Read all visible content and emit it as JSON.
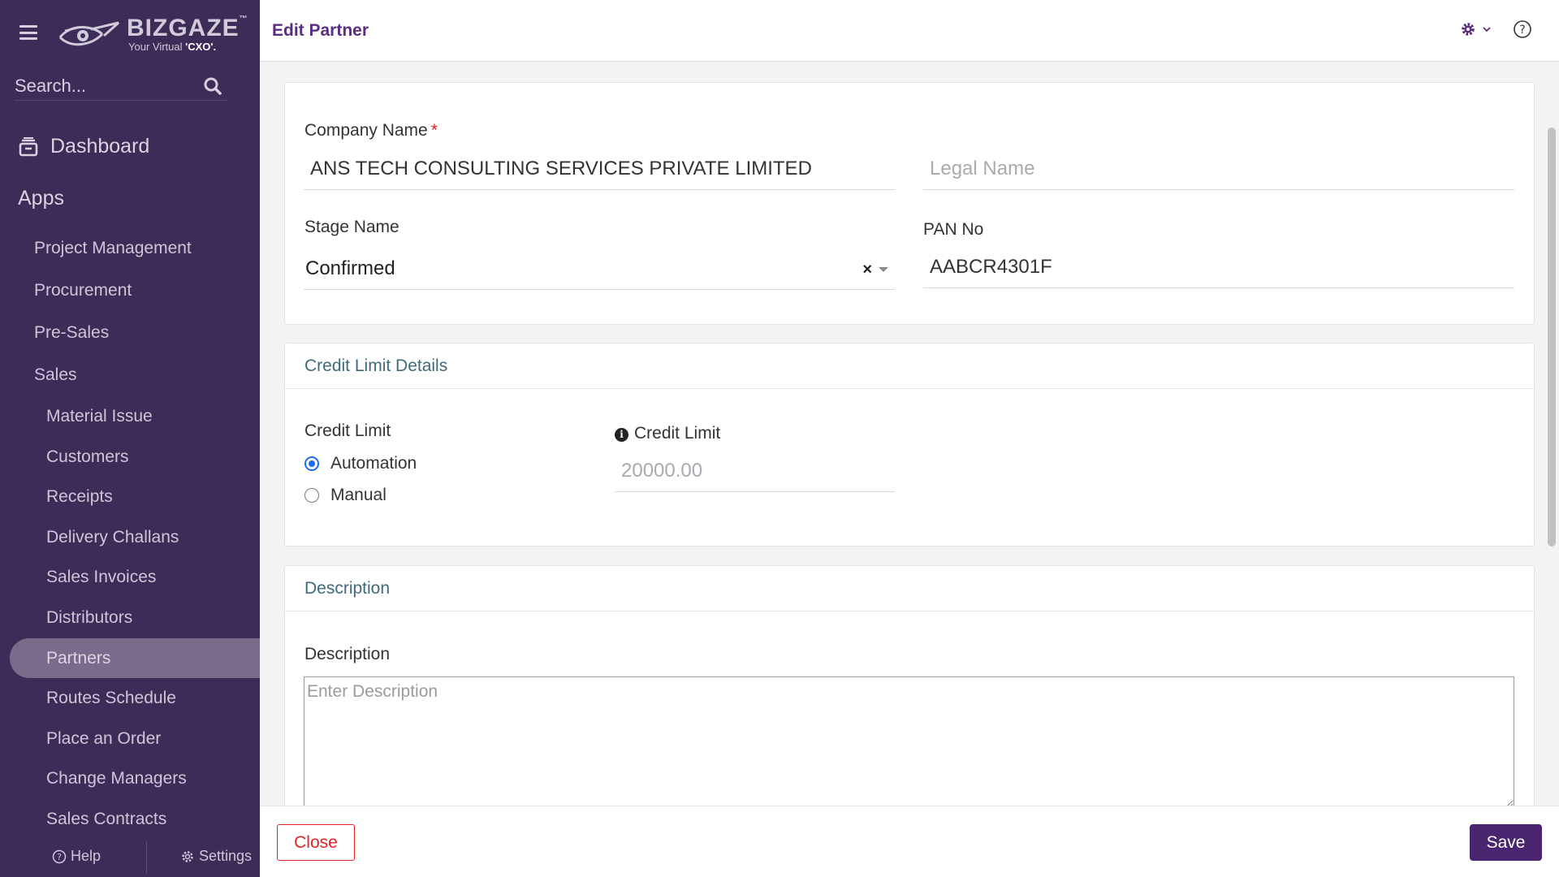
{
  "brand": {
    "name": "BIZGAZE",
    "trademark": "™",
    "tagline_prefix": "Your Virtual ",
    "tagline_strong": "'CXO'."
  },
  "sidebar": {
    "search_placeholder": "Search...",
    "dashboard_label": "Dashboard",
    "apps_label": "Apps",
    "items": [
      {
        "label": "Project Management",
        "level": 1
      },
      {
        "label": "Procurement",
        "level": 1
      },
      {
        "label": "Pre-Sales",
        "level": 1
      },
      {
        "label": "Sales",
        "level": 1
      }
    ],
    "sales_items": [
      {
        "label": "Material Issue"
      },
      {
        "label": "Customers"
      },
      {
        "label": "Receipts"
      },
      {
        "label": "Delivery Challans"
      },
      {
        "label": "Sales Invoices"
      },
      {
        "label": "Distributors"
      },
      {
        "label": "Partners",
        "active": true
      },
      {
        "label": "Routes Schedule"
      },
      {
        "label": "Place an Order"
      },
      {
        "label": "Change Managers"
      },
      {
        "label": "Sales Contracts"
      }
    ],
    "footer": {
      "help_label": "Help",
      "settings_label": "Settings"
    }
  },
  "header": {
    "title": "Edit Partner"
  },
  "form": {
    "company_name": {
      "label": "Company Name",
      "required_mark": "*",
      "value": "ANS TECH CONSULTING SERVICES PRIVATE LIMITED"
    },
    "legal_name": {
      "placeholder": "Legal Name",
      "value": ""
    },
    "stage_name": {
      "label": "Stage Name",
      "value": "Confirmed",
      "clear": "×"
    },
    "pan_no": {
      "label": "PAN No",
      "value": "AABCR4301F"
    }
  },
  "credit_section": {
    "title": "Credit Limit Details",
    "credit_limit_label": "Credit Limit",
    "options": [
      {
        "label": "Automation",
        "selected": true
      },
      {
        "label": "Manual",
        "selected": false
      }
    ],
    "amount_label": "Credit Limit",
    "amount_placeholder": "20000.00"
  },
  "description_section": {
    "title": "Description",
    "label": "Description",
    "placeholder": "Enter Description"
  },
  "actions": {
    "close_label": "Close",
    "save_label": "Save"
  },
  "colors": {
    "sidebar_bg": "#3e2c58",
    "title_purple": "#5a2d82",
    "save_bg": "#4a2670",
    "close_red": "#e0242a",
    "section_title": "#3f6a7d"
  }
}
